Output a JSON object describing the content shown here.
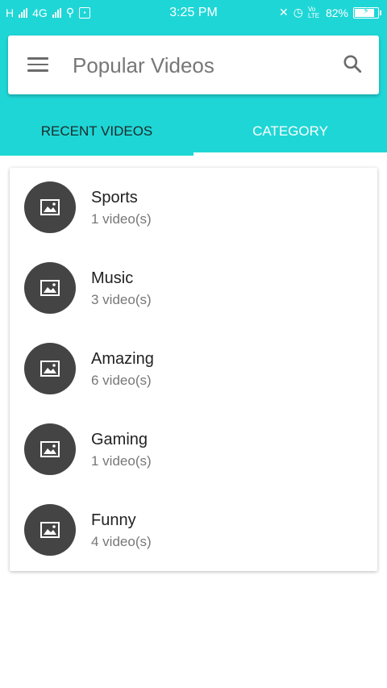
{
  "status_bar": {
    "network_left": "H",
    "network_type": "4G",
    "time": "3:25 PM",
    "volte": "Vo LTE",
    "battery": "82%",
    "color": "#1fd6d6"
  },
  "toolbar": {
    "title": "Popular Videos",
    "menu_icon": "hamburger-menu-icon",
    "search_icon": "search-icon"
  },
  "tabs": [
    {
      "label": "RECENT VIDEOS"
    },
    {
      "label": "CATEGORY",
      "selected": true
    }
  ],
  "categories": [
    {
      "name": "Sports",
      "count": "1 video(s)",
      "icon": "image-icon"
    },
    {
      "name": "Music",
      "count": "3 video(s)",
      "icon": "image-icon"
    },
    {
      "name": "Amazing",
      "count": "6 video(s)",
      "icon": "image-icon"
    },
    {
      "name": "Gaming",
      "count": "1 video(s)",
      "icon": "image-icon"
    },
    {
      "name": "Funny",
      "count": "4 video(s)",
      "icon": "image-icon"
    }
  ]
}
